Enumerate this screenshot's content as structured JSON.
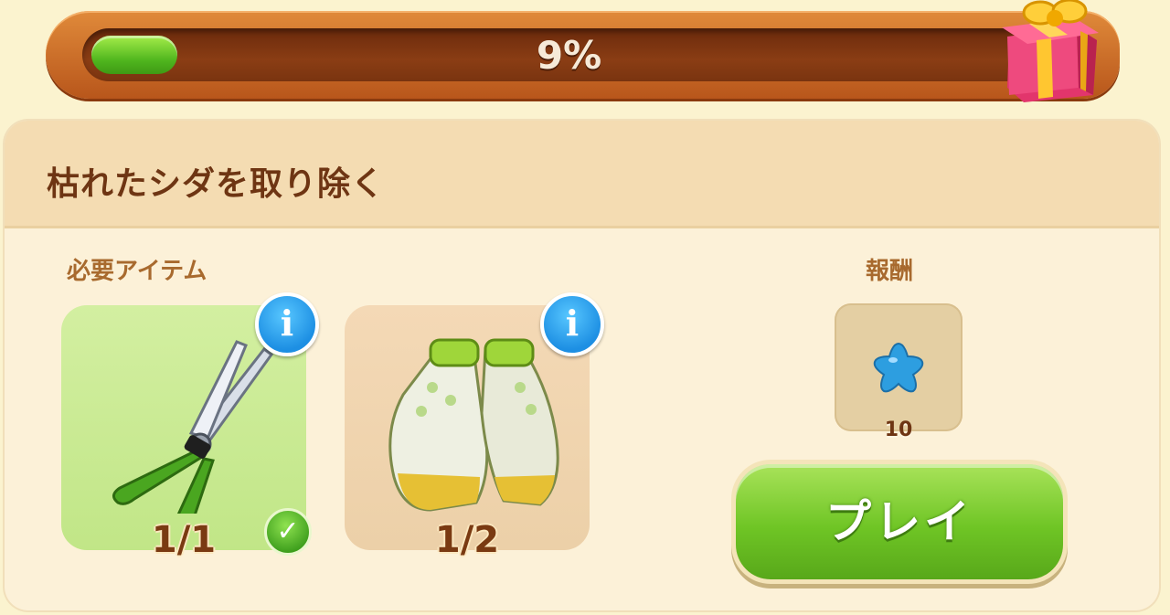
{
  "progress": {
    "percent_text": "9%",
    "fraction": 0.09,
    "bar_color": "#5fbe24",
    "reward_icon": "gift-box-icon"
  },
  "task": {
    "title": "枯れたシダを取り除く",
    "required_label": "必要アイテム",
    "reward_label": "報酬",
    "items": [
      {
        "icon": "pruning-shears-icon",
        "count": "1/1",
        "complete": true
      },
      {
        "icon": "garden-gloves-icon",
        "count": "1/2",
        "complete": false
      }
    ],
    "reward": {
      "icon": "blue-star-icon",
      "amount": "10"
    },
    "play_label": "プレイ"
  },
  "colors": {
    "frame": "#c96a24",
    "header": "#f4dcb2",
    "title_text": "#6e3513",
    "play_button": "#6fc525",
    "info_button": "#1d8fe3"
  }
}
